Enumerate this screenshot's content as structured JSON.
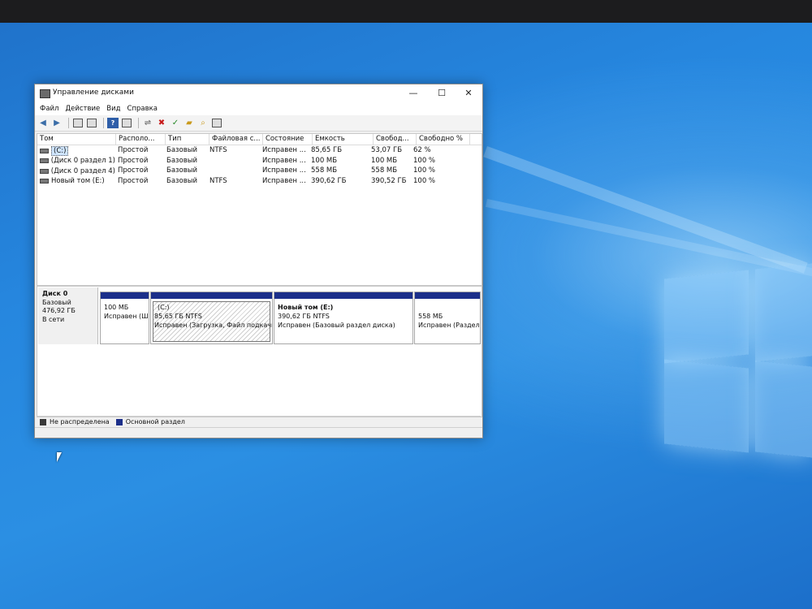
{
  "window": {
    "title": "Управление дисками",
    "controls": {
      "minimize": "—",
      "maximize": "☐",
      "close": "✕"
    }
  },
  "menu": [
    "Файл",
    "Действие",
    "Вид",
    "Справка"
  ],
  "toolbar_icons": [
    "back-icon",
    "forward-icon",
    "properties-icon",
    "list-view-icon",
    "help-icon",
    "settings-icon",
    "connect-icon",
    "delete-icon",
    "check-icon",
    "new-folder-icon",
    "search-icon",
    "details-icon"
  ],
  "volumes": {
    "headers": [
      "Том",
      "Располо...",
      "Тип",
      "Файловая с...",
      "Состояние",
      "Емкость",
      "Свобод...",
      "Свободно %"
    ],
    "rows": [
      [
        "(C:)",
        "Простой",
        "Базовый",
        "NTFS",
        "Исправен ...",
        "85,65 ГБ",
        "53,07 ГБ",
        "62 %"
      ],
      [
        "(Диск 0 раздел 1)",
        "Простой",
        "Базовый",
        "",
        "Исправен ...",
        "100 МБ",
        "100 МБ",
        "100 %"
      ],
      [
        "(Диск 0 раздел 4)",
        "Простой",
        "Базовый",
        "",
        "Исправен ...",
        "558 МБ",
        "558 МБ",
        "100 %"
      ],
      [
        "Новый том (E:)",
        "Простой",
        "Базовый",
        "NTFS",
        "Исправен ...",
        "390,62 ГБ",
        "390,52 ГБ",
        "100 %"
      ]
    ]
  },
  "disk": {
    "name": "Диск 0",
    "type": "Базовый",
    "size": "476,92 ГБ",
    "status": "В сети",
    "partitions": [
      {
        "name": "",
        "size": "100 МБ",
        "status": "Исправен (Ш"
      },
      {
        "name": "(C:)",
        "size": "85,65 ГБ NTFS",
        "status": "Исправен (Загрузка, Файл подкачк"
      },
      {
        "name": "Новый том  (E:)",
        "size": "390,62 ГБ NTFS",
        "status": "Исправен (Базовый раздел диска)"
      },
      {
        "name": "",
        "size": "558 МБ",
        "status": "Исправен (Раздел"
      }
    ]
  },
  "legend": {
    "unallocated": "Не распределена",
    "primary": "Основной раздел",
    "unallocated_color": "#3a3a3a",
    "primary_color": "#1c2f8a"
  }
}
